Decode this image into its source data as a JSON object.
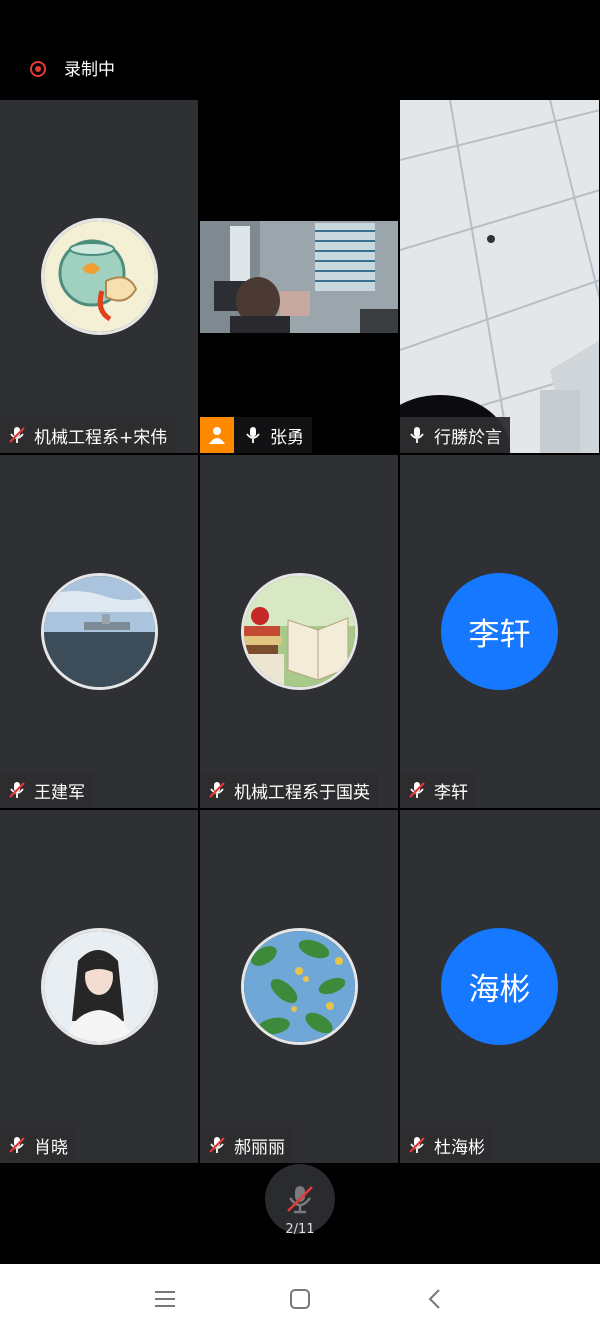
{
  "header": {
    "recording_label": "录制中"
  },
  "participants": [
    {
      "name": "机械工程系+宋伟",
      "muted": true
    },
    {
      "name": "张勇",
      "muted": false,
      "host": true
    },
    {
      "name": "行勝於言",
      "muted": false
    },
    {
      "name": "王建军",
      "muted": true
    },
    {
      "name": "机械工程系于国英",
      "muted": true
    },
    {
      "name": "李轩",
      "muted": true,
      "initials": "李轩"
    },
    {
      "name": "肖晓",
      "muted": true
    },
    {
      "name": "郝丽丽",
      "muted": true
    },
    {
      "name": "杜海彬",
      "muted": true,
      "initials": "海彬"
    }
  ],
  "controls": {
    "mic_icon": "muted-mic-icon",
    "page_indicator": "2/11"
  },
  "colors": {
    "recording": "#e53935",
    "initials_bg": "#1677ff",
    "host_badge": "#ff8a00",
    "tile_bg": "#2f3034"
  },
  "nav": {
    "icons": [
      "menu-icon",
      "home-icon",
      "back-icon"
    ]
  }
}
